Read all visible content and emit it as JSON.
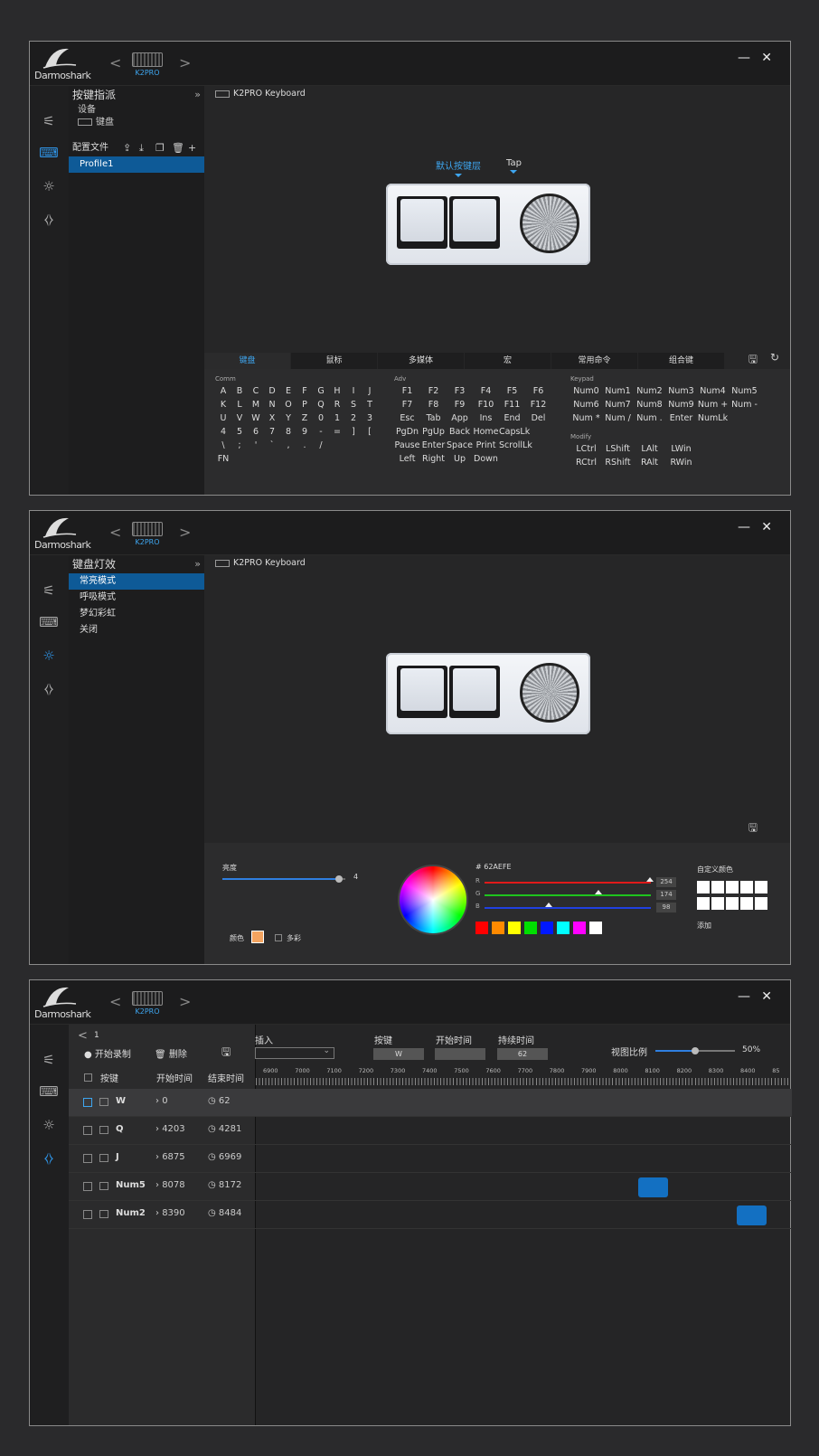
{
  "brand": {
    "logo_text": "Darmoshark",
    "device_label": "K2PRO"
  },
  "window": {
    "minimize": "—",
    "close": "✕",
    "prev": "<",
    "next": ">"
  },
  "icons": {
    "rail": [
      "sliders-icon",
      "keyboard-icon",
      "lightbulb-icon",
      "code-icon"
    ]
  },
  "w1": {
    "side_title": "按键指派",
    "side_collapse": "»",
    "device_heading": "设备",
    "device_name": "键盘",
    "config_label": "配置文件",
    "profile": "Profile1",
    "main_title": "K2PRO Keyboard",
    "layer_default": "默认按键层",
    "layer_tap": "Tap",
    "tabs": [
      "键盘",
      "鼠标",
      "多媒体",
      "宏",
      "常用命令",
      "组合键"
    ],
    "groups": {
      "comm_title": "Comm",
      "comm": [
        "A",
        "B",
        "C",
        "D",
        "E",
        "F",
        "G",
        "H",
        "I",
        "J",
        "K",
        "L",
        "M",
        "N",
        "O",
        "P",
        "Q",
        "R",
        "S",
        "T",
        "U",
        "V",
        "W",
        "X",
        "Y",
        "Z",
        "0",
        "1",
        "2",
        "3",
        "4",
        "5",
        "6",
        "7",
        "8",
        "9",
        "-",
        "=",
        "]",
        "[",
        "\\",
        ";",
        "'",
        "`",
        ",",
        ".",
        "/",
        "",
        "",
        "",
        "FN"
      ],
      "adv_title": "Adv",
      "adv": [
        "F1",
        "F2",
        "F3",
        "F4",
        "F5",
        "F6",
        "F7",
        "F8",
        "F9",
        "F10",
        "F11",
        "F12",
        "Esc",
        "Tab",
        "App",
        "Ins",
        "End",
        "Del",
        "PgDn",
        "PgUp",
        "Back",
        "Home",
        "CapsLk",
        "",
        "Pause",
        "Enter",
        "Space",
        "Print",
        "ScrollLk",
        "",
        "Left",
        "Right",
        "Up",
        "Down",
        "",
        ""
      ],
      "keypad_title": "Keypad",
      "keypad": [
        "Num0",
        "Num1",
        "Num2",
        "Num3",
        "Num4",
        "Num5",
        "Num6",
        "Num7",
        "Num8",
        "Num9",
        "Num +",
        "Num -",
        "Num *",
        "Num /",
        "Num .",
        "Enter",
        "NumLk",
        ""
      ],
      "modify_title": "Modify",
      "modify": [
        "LCtrl",
        "LShift",
        "LAlt",
        "LWin",
        "RCtrl",
        "RShift",
        "RAlt",
        "RWin"
      ]
    }
  },
  "w2": {
    "side_title": "键盘灯效",
    "side_collapse": "»",
    "modes": [
      "常亮模式",
      "呼吸模式",
      "梦幻彩虹",
      "关闭"
    ],
    "main_title": "K2PRO Keyboard",
    "brightness_label": "亮度",
    "brightness_value": "4",
    "brightness_level": 0.95,
    "color_label": "颜色",
    "multicolor_label": "多彩",
    "current_color": "#F4A460",
    "hex": "# 62AEFE",
    "r_label": "R",
    "g_label": "G",
    "b_label": "B",
    "r": "254",
    "g": "174",
    "b": "98",
    "swatches": [
      "#ff0000",
      "#ff8a00",
      "#ffff00",
      "#00e000",
      "#0018ff",
      "#00ffff",
      "#ff00ff",
      "#ffffff"
    ],
    "custom_label": "自定义颜色",
    "add_label": "添加"
  },
  "w3": {
    "back": "<",
    "page": "1",
    "record": "● 开始录制",
    "delete": "🗑 删除",
    "insert_label": "插入",
    "key_label": "按键",
    "start_label": "开始时间",
    "duration_label": "持续时间",
    "key_value": "W",
    "start_value": "",
    "duration_value": "62",
    "zoom_label": "视图比例",
    "zoom_value": "50%",
    "zoom_level": 0.5,
    "col_key": "按键",
    "col_start": "开始时间",
    "col_end": "结束时间",
    "ticks": [
      "6900",
      "7000",
      "7100",
      "7200",
      "7300",
      "7400",
      "7500",
      "7600",
      "7700",
      "7800",
      "7900",
      "8000",
      "8100",
      "8200",
      "8300",
      "8400",
      "85"
    ],
    "rows": [
      {
        "key": "W",
        "start": "0",
        "end": "62",
        "selected": true
      },
      {
        "key": "Q",
        "start": "4203",
        "end": "4281",
        "selected": false
      },
      {
        "key": "J",
        "start": "6875",
        "end": "6969",
        "selected": false
      },
      {
        "key": "Num5",
        "start": "8078",
        "end": "8172",
        "selected": false
      },
      {
        "key": "Num2",
        "start": "8390",
        "end": "8484",
        "selected": false
      }
    ]
  }
}
